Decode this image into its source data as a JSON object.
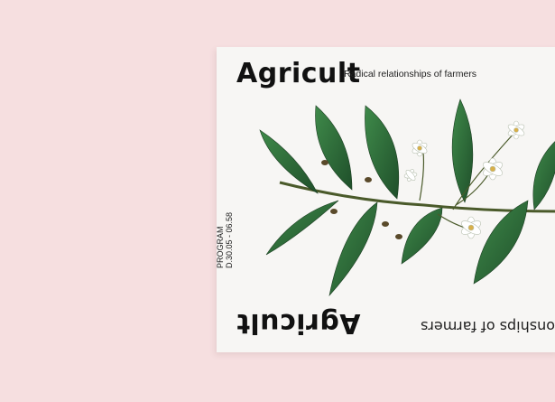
{
  "poster": {
    "title": "Agricult",
    "subtitle": "Radical relationships of farmers",
    "title_flipped": "Agricult",
    "subtitle_flipped": "tionships of farmers",
    "program_label": "PROGRAM",
    "program_dates": "D.30.05 - 06.58"
  },
  "illustration": {
    "leaf_color": "#2f6b3a",
    "flower_color": "#ffffff",
    "stem_color": "#4a5a2a"
  }
}
